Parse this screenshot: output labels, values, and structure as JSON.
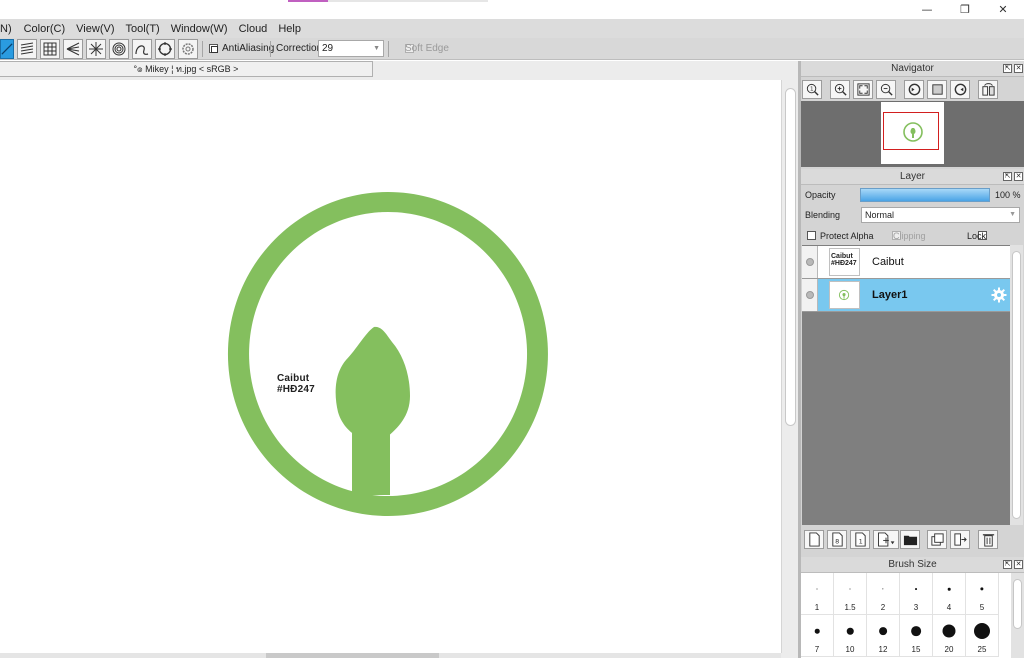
{
  "window": {
    "minimize_glyph": "—",
    "restore_glyph": "❐",
    "close_glyph": "✕"
  },
  "menu": [
    "N)",
    "Color(C)",
    "View(V)",
    "Tool(T)",
    "Window(W)",
    "Cloud",
    "Help"
  ],
  "toolbar": {
    "antialiasing_label": "AntiAliasing",
    "correction_label": "Correction",
    "correction_value": "29",
    "soft_edge_label": "Soft Edge"
  },
  "document": {
    "tab_label": "°๏ Mikey ¦ ท.jpg < sRGB >"
  },
  "artwork": {
    "text_line1": "Caibut",
    "text_line2": "#HĐ247",
    "color": "#84bf5e"
  },
  "navigator": {
    "title": "Navigator"
  },
  "layer_panel": {
    "title": "Layer",
    "opacity_label": "Opacity",
    "opacity_value": "100 %",
    "blending_label": "Blending",
    "blending_value": "Normal",
    "protect_alpha_label": "Protect Alpha",
    "clipping_label": "Clipping",
    "lock_label": "Lock",
    "layers": [
      {
        "name": "Caibut",
        "thumb_text1": "Caibut",
        "thumb_text2": "#HĐ247",
        "selected": false
      },
      {
        "name": "Layer1",
        "selected": true
      }
    ],
    "selected_color": "#79c8ef"
  },
  "brush_panel": {
    "title": "Brush Size",
    "sizes": [
      "1",
      "1.5",
      "2",
      "3",
      "4",
      "5",
      "7",
      "10",
      "12",
      "15",
      "20",
      "25"
    ]
  },
  "colors": {
    "accent_blue": "#2a9be0",
    "panel_gray": "#d4d4d4",
    "layer_bg": "#7f7f7f"
  }
}
